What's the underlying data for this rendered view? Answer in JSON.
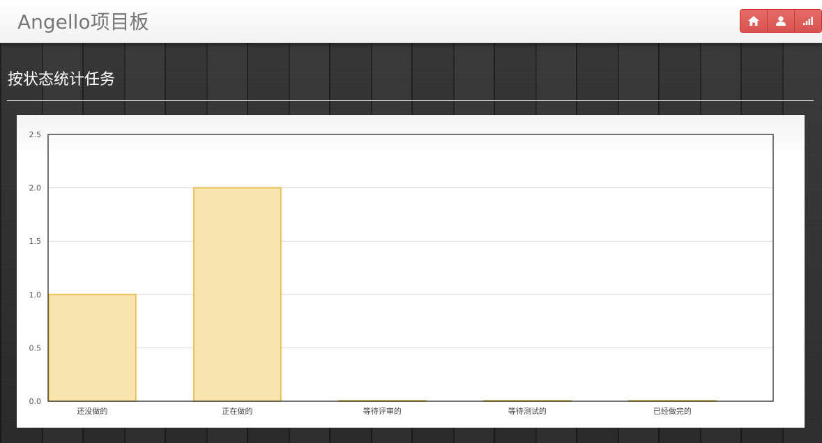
{
  "header": {
    "brand": "Angello项目板",
    "buttons": [
      {
        "icon": "home-icon"
      },
      {
        "icon": "user-icon"
      },
      {
        "icon": "signal-icon"
      }
    ]
  },
  "page": {
    "title": "按状态统计任务"
  },
  "colors": {
    "bar_fill": "#f8e5b0",
    "bar_stroke": "#e8c35a",
    "button_red": "#d9534f"
  },
  "chart_data": {
    "type": "bar",
    "categories": [
      "还没做的",
      "正在做的",
      "等待评审的",
      "等待测试的",
      "已经做完的"
    ],
    "values": [
      1,
      2,
      0,
      0,
      0
    ],
    "yticks": [
      "0.0",
      "0.5",
      "1.0",
      "1.5",
      "2.0",
      "2.5"
    ],
    "ylim": [
      0,
      2.5
    ],
    "grid": true
  }
}
